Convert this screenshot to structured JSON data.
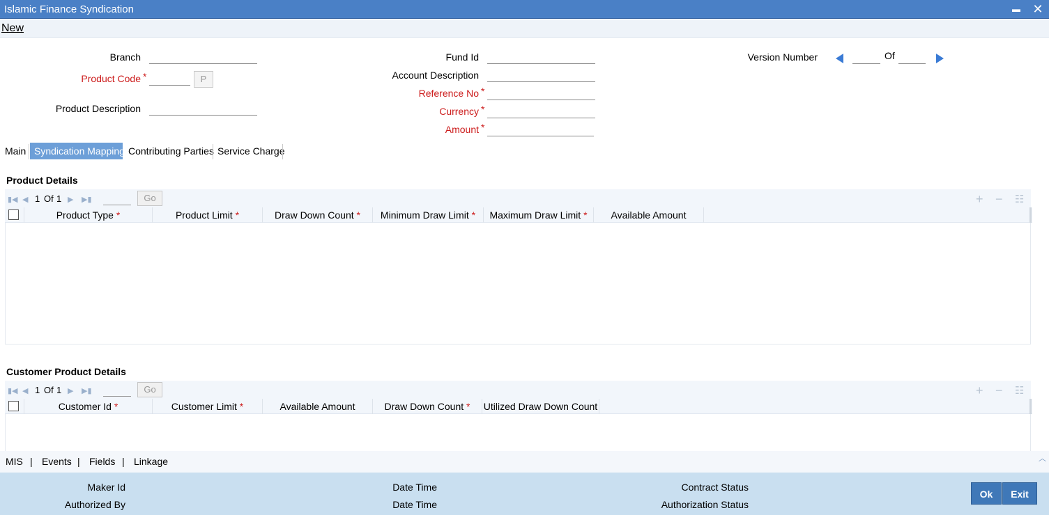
{
  "window": {
    "title": "Islamic Finance Syndication",
    "minimize_glyph": "▬",
    "close_glyph": "✕"
  },
  "menu": {
    "new_label": "New"
  },
  "form": {
    "branch_label": "Branch",
    "product_code_label": "Product Code",
    "product_code_button": "P",
    "product_description_label": "Product Description",
    "fund_id_label": "Fund Id",
    "account_description_label": "Account Description",
    "reference_no_label": "Reference No",
    "currency_label": "Currency",
    "amount_label": "Amount",
    "version_number_label": "Version Number",
    "of_label": "Of",
    "required_mark": "*"
  },
  "tabs": [
    {
      "label": "Main",
      "active": false
    },
    {
      "label": "Syndication Mapping",
      "active": true
    },
    {
      "label": "Contributing Parties",
      "active": false
    },
    {
      "label": "Service Charge",
      "active": false
    }
  ],
  "product_details": {
    "title": "Product Details",
    "pager": {
      "current": "1",
      "of": "Of",
      "total": "1",
      "go": "Go"
    },
    "columns": [
      {
        "label": "Product Type",
        "required": true
      },
      {
        "label": "Product Limit",
        "required": true
      },
      {
        "label": "Draw Down Count",
        "required": true
      },
      {
        "label": "Minimum Draw Limit",
        "required": true
      },
      {
        "label": "Maximum Draw Limit",
        "required": true
      },
      {
        "label": "Available Amount",
        "required": false
      }
    ]
  },
  "customer_product_details": {
    "title": "Customer Product Details",
    "pager": {
      "current": "1",
      "of": "Of",
      "total": "1",
      "go": "Go"
    },
    "columns": [
      {
        "label": "Customer Id",
        "required": true
      },
      {
        "label": "Customer Limit",
        "required": true
      },
      {
        "label": "Available Amount",
        "required": false
      },
      {
        "label": "Draw Down Count",
        "required": true
      },
      {
        "label": "Utilized Draw Down Count",
        "required": false
      }
    ]
  },
  "footer_links": [
    "MIS",
    "Events",
    "Fields",
    "Linkage"
  ],
  "footer_link_separator": "|",
  "footer": {
    "maker_id_label": "Maker Id",
    "authorized_by_label": "Authorized By",
    "date_time_label": "Date Time",
    "contract_status_label": "Contract Status",
    "authorization_status_label": "Authorization Status",
    "ok_label": "Ok",
    "exit_label": "Exit"
  },
  "colors": {
    "titlebar": "#4a80c6",
    "active_tab": "#6d9fd8",
    "required": "#cc1b1b",
    "footer": "#c9dff0",
    "button": "#3f78b8"
  }
}
